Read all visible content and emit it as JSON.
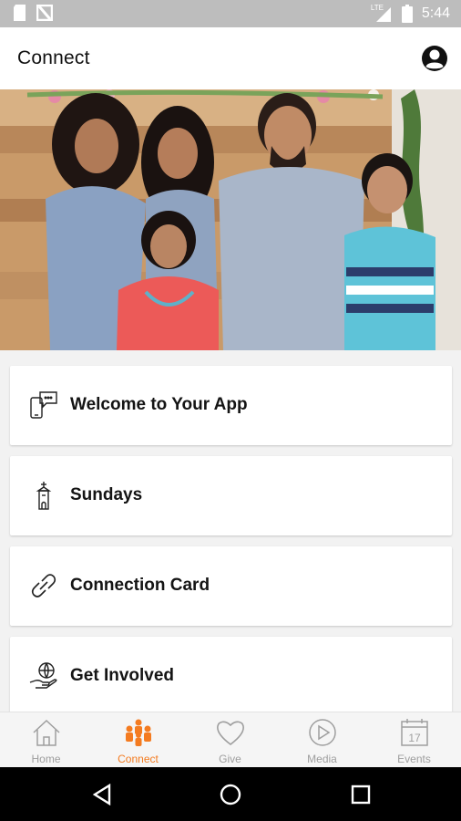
{
  "status_bar": {
    "time": "5:44",
    "network": "LTE"
  },
  "app_bar": {
    "title": "Connect"
  },
  "colors": {
    "accent": "#f47b20",
    "inactive_tab": "#9e9e9e",
    "status_bar": "#bdbdbd"
  },
  "cards": [
    {
      "label": "Welcome to Your App",
      "icon": "devices-chat-icon"
    },
    {
      "label": "Sundays",
      "icon": "church-tower-icon"
    },
    {
      "label": "Connection Card",
      "icon": "link-icon"
    },
    {
      "label": "Get Involved",
      "icon": "hand-heart-globe-icon"
    }
  ],
  "tabs": [
    {
      "label": "Home",
      "icon": "home-icon",
      "active": false
    },
    {
      "label": "Connect",
      "icon": "people-group-icon",
      "active": true
    },
    {
      "label": "Give",
      "icon": "heart-icon",
      "active": false
    },
    {
      "label": "Media",
      "icon": "play-circle-icon",
      "active": false
    },
    {
      "label": "Events",
      "icon": "calendar-icon",
      "active": false,
      "calendar_day": "17"
    }
  ]
}
